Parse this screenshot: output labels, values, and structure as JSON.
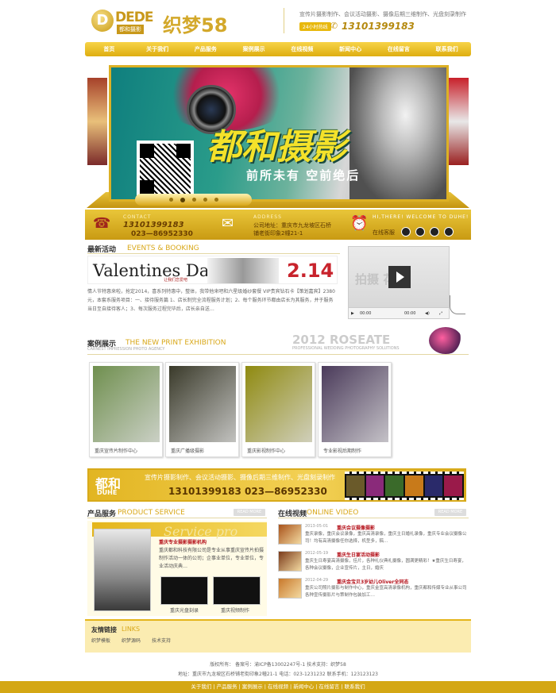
{
  "header": {
    "logo_badge": "D",
    "logo_brand": "DEDE",
    "logo_sub": "都和摄影",
    "logo_name": "织梦58",
    "services": "宣传片摄影制作、会议活动摄影、摄像后期三维制作、光盘刻录制作",
    "hotline_label": "24小时热线",
    "phone": "13101399183"
  },
  "nav": [
    "首页",
    "关于我们",
    "产品服务",
    "案例展示",
    "在线视频",
    "新闻中心",
    "在线留言",
    "联系我们"
  ],
  "banner": {
    "title": "都和摄影",
    "slogan": "前所未有  空前绝后",
    "slide_count": 5,
    "active_slide": 2
  },
  "contact": {
    "label": "CONTACT",
    "phone1": "13101399183",
    "phone2": "023—86952330",
    "address_label": "ADDRESS",
    "address": "公司地址：重庆市九龙坡区石桥铺老街印象2幢21-1",
    "welcome": "HI,THERE! WELCOME TO DUHE!",
    "online_service": "在线客服"
  },
  "news": {
    "title": "最新活动",
    "title_en": "EVENTS & BOOKING",
    "promo_text": "Valentines Day",
    "promo_sub": "让我们恋爱吧",
    "promo_date": "2.14",
    "body": "情人节特惠来啦，抢定2014，喜系列特惠中，整体，我带他来吧和六星级婚纱套餐 VIP贵宾钻石卡【策划嘉宾】2380元，本套系服务项目：一、接待服务篇 1、店长制完全流程服务计划；2、每个服务环节都由店长为其服务，并于服务当日至自接待客人；3、每次服务过程完毕后，店长亲自送…"
  },
  "video": {
    "watermark": "拍摄    花絮",
    "time_current": "00:00",
    "time_total": "00:00"
  },
  "cases": {
    "title": "案例展示",
    "title_en": "THE NEW PRINT EXHIBITION",
    "subtitle": "CARNEST IMPRESSION PHOTO AGENCY",
    "roseate": "2012 ROSEATE",
    "roseate_sub": "PROFESSIONAL WEDDING PHOTOGRAPHY SOLUTIONS",
    "items": [
      {
        "label": "重庆宣传片制作中心",
        "color": "#6f8f4e"
      },
      {
        "label": "重庆广播级摄影",
        "color": "#3a3a2a"
      },
      {
        "label": "重庆影视制作中心",
        "color": "#8f8a10"
      },
      {
        "label": "专业影视后期制作",
        "color": "#4a3a5a"
      }
    ]
  },
  "strip": {
    "logo": "都和",
    "logo_en": "DUHE",
    "services": "宣传片摄影制作、会议活动摄影、摄像后期三维制作、光盘刻录制作",
    "phones": "13101399183    023—86952330",
    "film_colors": [
      "#6a5a2a",
      "#8a2a7a",
      "#3a6a2a",
      "#c87a1a",
      "#2a2a6a",
      "#9a1a4a"
    ]
  },
  "products": {
    "title": "产品服务",
    "title_en": "PRODUCT SERVICE",
    "more": "READ MORE",
    "script": "Service pro",
    "headline": "重庆专业摄影摄影机构",
    "text": "重庆都和科技有限公司是专业从事重庆宣传片拍摄制作活动一体的公司；企事业单位，专业单位，专业活动庆典…",
    "cd1_label": "重庆光盘刻录",
    "cd2_label": "重庆视频制作"
  },
  "videos": {
    "title": "在线视频",
    "title_en": "ONLINE VIDEO",
    "more": "READ MORE",
    "items": [
      {
        "date": "2013-05-01",
        "title": "重庆会议摄像摄影",
        "desc": "重庆录像，重庆会议录像，重庆高清录像，重庆主日婚礼录像，重庆专业会议摄像公司！均有高清摄像任你选择，机型多，稿…",
        "color": "#a8521a"
      },
      {
        "date": "2012-05-19",
        "title": "重庆生日宴活动摄影",
        "desc": "重庆生日寿宴高清摄像，佳片，各种礼仪典礼摄像，圆满更精彩！★重庆生日寿宴，各种会议摄像，企业宣传片，主日，婚庆",
        "color": "#7a3a1a"
      },
      {
        "date": "2012-04-29",
        "title": "重庆金宝贝3岁幼儿Oliver全同态",
        "desc": "重庆公司照片摄影与制作中心，重庆金宣高清录像机构，重庆都和传媒专业从事公司各种宣传摄影片与策制作包装加工…",
        "color": "#c8782a"
      }
    ]
  },
  "links": {
    "title": "友情链接",
    "title_en": "LINKS",
    "items": [
      "织梦模板",
      "织梦源码",
      "技术支持"
    ]
  },
  "footer": {
    "copyright": "版权所有：  备案号：渝ICP备13002247号-1  技术支持：织梦58",
    "address": "地址：重庆市九龙坡区石桥铺老街印象2幢21-1  电话：023-1231232  联系手机：123123123",
    "nav": [
      "关于我们",
      "产品服务",
      "案例展示",
      "在线视频",
      "新闻中心",
      "在线留言",
      "联系我们"
    ]
  },
  "colors": {
    "accent": "#d9a81a",
    "red": "#b5121b"
  }
}
